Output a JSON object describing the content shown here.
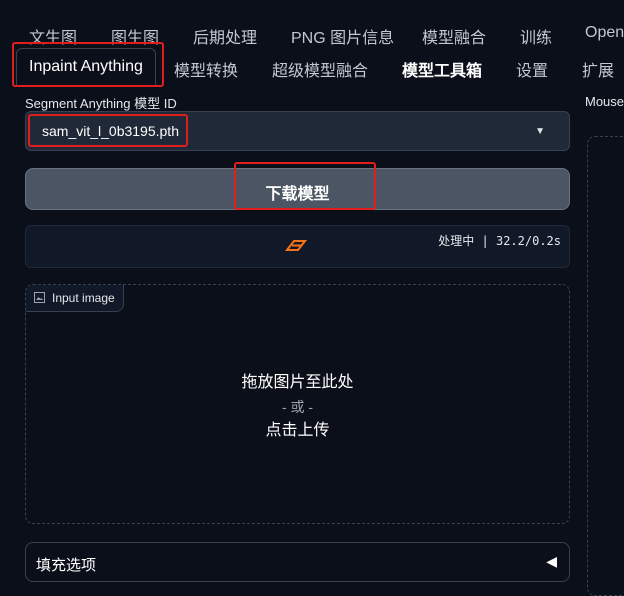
{
  "tabs_row1": [
    "文生图",
    "图生图",
    "后期处理",
    "PNG 图片信息",
    "模型融合",
    "训练",
    "OpenP"
  ],
  "tabs_row2": {
    "active": "Inpaint Anything",
    "others": [
      "模型转换",
      "超级模型融合",
      "模型工具箱",
      "设置",
      "扩展"
    ]
  },
  "model_select": {
    "label": "Segment Anything 模型 ID",
    "value": "sam_vit_l_0b3195.pth"
  },
  "download_button": "下载模型",
  "status": {
    "text": "处理中 | 32.2/0.2s"
  },
  "input_image": {
    "label": "Input image",
    "drop_line1": "拖放图片至此处",
    "drop_line2": "- 或 -",
    "drop_line3": "点击上传"
  },
  "accordion": {
    "title": "填充选项",
    "arrow": "◀"
  },
  "right_panel": {
    "label": "Mouse"
  },
  "colors": {
    "background": "#0b0f19",
    "highlight_box": "#e11d1d",
    "loader": "#f97316"
  }
}
